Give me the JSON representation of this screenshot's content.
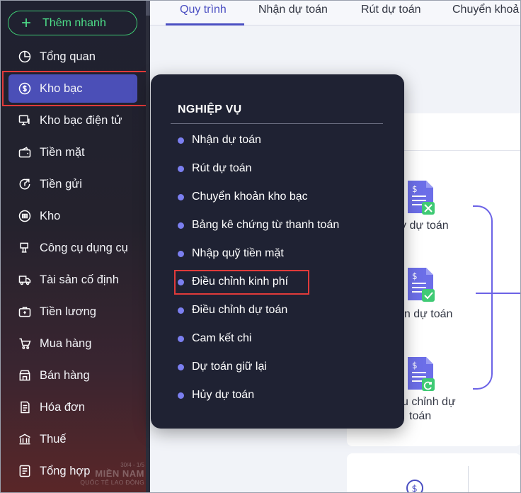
{
  "sidebar": {
    "quick_add": "Thêm nhanh",
    "items": [
      {
        "label": "Tổng quan",
        "icon": "pie-chart-icon"
      },
      {
        "label": "Kho bạc",
        "icon": "dollar-circle-icon"
      },
      {
        "label": "Kho bạc điện tử",
        "icon": "monitor-dollar-icon"
      },
      {
        "label": "Tiền mặt",
        "icon": "wallet-icon"
      },
      {
        "label": "Tiền gửi",
        "icon": "deposit-icon"
      },
      {
        "label": "Kho",
        "icon": "warehouse-icon"
      },
      {
        "label": "Công cụ dụng cụ",
        "icon": "tools-icon"
      },
      {
        "label": "Tài sản cố định",
        "icon": "truck-icon"
      },
      {
        "label": "Tiền lương",
        "icon": "salary-icon"
      },
      {
        "label": "Mua hàng",
        "icon": "cart-icon"
      },
      {
        "label": "Bán hàng",
        "icon": "store-icon"
      },
      {
        "label": "Hóa đơn",
        "icon": "invoice-icon"
      },
      {
        "label": "Thuế",
        "icon": "bank-icon"
      },
      {
        "label": "Tổng hợp",
        "icon": "report-icon"
      }
    ],
    "active_index": 1
  },
  "watermark": {
    "line1": "30/4 - 1/5",
    "line2": "MIỀN NAM",
    "line3": "QUỐC TẾ LAO ĐỘNG"
  },
  "tabs": [
    {
      "label": "Quy trình",
      "active": true
    },
    {
      "label": "Nhận dự toán",
      "active": false
    },
    {
      "label": "Rút dự toán",
      "active": false
    },
    {
      "label": "Chuyển khoả",
      "active": false
    }
  ],
  "flow": {
    "items": [
      {
        "label": "y dự toán",
        "icon": "document-cancel-icon"
      },
      {
        "label": "ận dự toán",
        "icon": "document-check-icon"
      },
      {
        "label": "u chỉnh dự",
        "label2": "toán",
        "icon": "document-refresh-icon"
      }
    ]
  },
  "popup": {
    "title": "NGHIỆP VỤ",
    "items": [
      "Nhận dự toán",
      "Rút dự toán",
      "Chuyển khoản kho bạc",
      "Bảng kê chứng từ thanh toán",
      "Nhập quỹ tiền mặt",
      "Điều chỉnh kinh phí",
      "Điều chỉnh dự toán",
      "Cam kết chi",
      "Dự toán giữ lại",
      "Hủy dự toán"
    ],
    "highlighted_index": 5
  },
  "colors": {
    "accent": "#4b4fc2",
    "green": "#3fca74",
    "highlight": "#e03a3a",
    "popup_bg": "#1f2233"
  }
}
